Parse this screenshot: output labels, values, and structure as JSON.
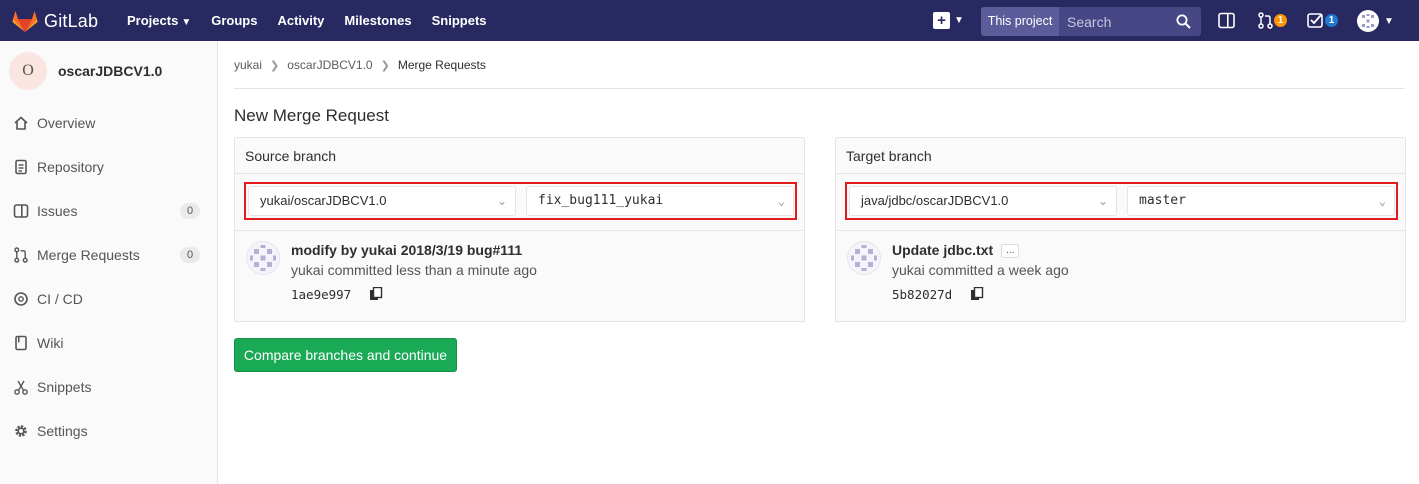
{
  "navbar": {
    "brand": "GitLab",
    "links": [
      "Projects",
      "Groups",
      "Activity",
      "Milestones",
      "Snippets"
    ],
    "search": {
      "scope": "This project",
      "placeholder": "Search"
    },
    "merge_requests_count": "1",
    "todos_count": "1",
    "colors": {
      "bg": "#292961",
      "orange_badge": "#fc9403",
      "blue_badge": "#1f78d1"
    },
    "icons": [
      "gitlab-logo",
      "chevron-down",
      "plus-square",
      "search",
      "sidebar-toggle",
      "merge-request",
      "todo-check",
      "user-avatar"
    ]
  },
  "sidebar": {
    "project_initial": "O",
    "project_name": "oscarJDBCV1.0",
    "items": [
      {
        "label": "Overview",
        "icon": "home"
      },
      {
        "label": "Repository",
        "icon": "doc-text"
      },
      {
        "label": "Issues",
        "icon": "issues",
        "count": "0"
      },
      {
        "label": "Merge Requests",
        "icon": "git-merge",
        "count": "0"
      },
      {
        "label": "CI / CD",
        "icon": "rocket"
      },
      {
        "label": "Wiki",
        "icon": "book"
      },
      {
        "label": "Snippets",
        "icon": "scissors"
      },
      {
        "label": "Settings",
        "icon": "gear"
      }
    ]
  },
  "breadcrumb": [
    "yukai",
    "oscarJDBCV1.0",
    "Merge Requests"
  ],
  "page_title": "New Merge Request",
  "source": {
    "header": "Source branch",
    "project": "yukai/oscarJDBCV1.0",
    "branch": "fix_bug111_yukai",
    "commit": {
      "title": "modify by yukai 2018/3/19 bug#111",
      "meta": "yukai committed less than a minute ago",
      "sha": "1ae9e997"
    }
  },
  "target": {
    "header": "Target branch",
    "project": "java/jdbc/oscarJDBCV1.0",
    "branch": "master",
    "commit": {
      "title": "Update jdbc.txt",
      "ellipsis": "...",
      "meta": "yukai committed a week ago",
      "sha": "5b82027d"
    }
  },
  "compare_button": "Compare branches and continue",
  "colors": {
    "highlight_border": "#e21c1c",
    "primary_green": "#1aaa55"
  }
}
